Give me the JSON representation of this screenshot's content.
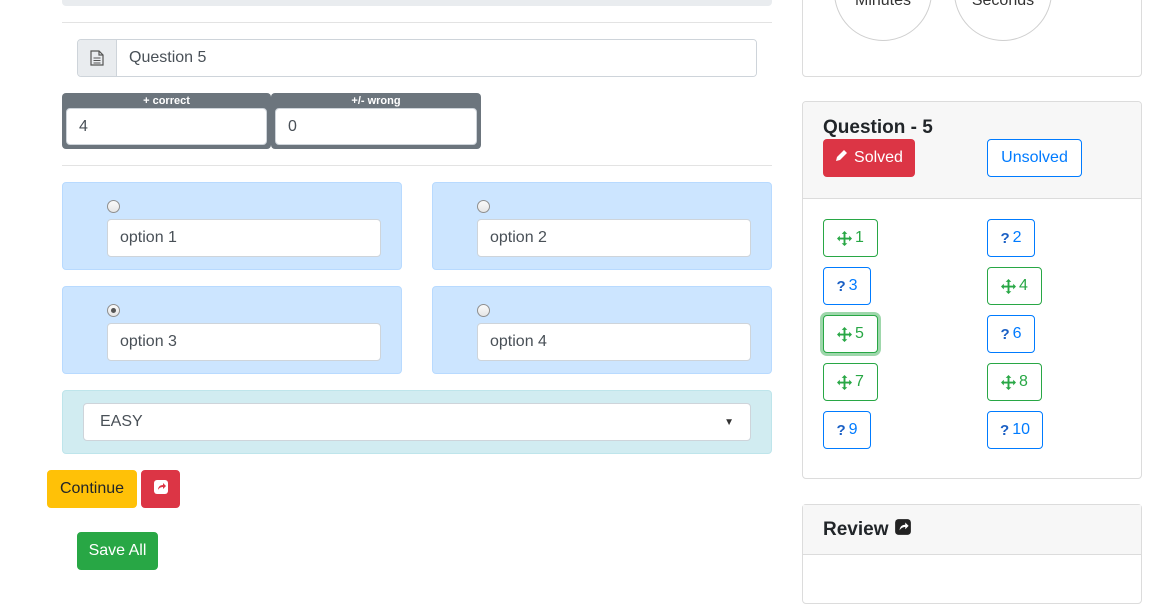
{
  "timer": {
    "minutes_label": "Minutes",
    "seconds_label": "Seconds"
  },
  "question": {
    "title_value": "Question 5"
  },
  "marks": {
    "correct_label": "+ correct",
    "correct_value": "4",
    "wrong_label": "+/- wrong",
    "wrong_value": "0"
  },
  "options": [
    {
      "value": "option 1",
      "checked": false
    },
    {
      "value": "option 2",
      "checked": false
    },
    {
      "value": "option 3",
      "checked": true
    },
    {
      "value": "option 4",
      "checked": false
    }
  ],
  "difficulty": {
    "selected": "EASY"
  },
  "actions": {
    "continue_label": "Continue",
    "save_all_label": "Save All"
  },
  "navigator": {
    "title": "Question - 5",
    "solved_label": "Solved",
    "unsolved_label": "Unsolved",
    "current": 5,
    "questions": [
      {
        "label": "1",
        "status": "solved"
      },
      {
        "label": "2",
        "status": "unsolved"
      },
      {
        "label": "3",
        "status": "unsolved"
      },
      {
        "label": "4",
        "status": "solved"
      },
      {
        "label": "5",
        "status": "solved"
      },
      {
        "label": "6",
        "status": "unsolved"
      },
      {
        "label": "7",
        "status": "solved"
      },
      {
        "label": "8",
        "status": "solved"
      },
      {
        "label": "9",
        "status": "unsolved"
      },
      {
        "label": "10",
        "status": "unsolved"
      }
    ]
  },
  "review": {
    "title": "Review"
  },
  "colors": {
    "solved": "#28a745",
    "unsolved": "#007bff",
    "danger": "#dc3545",
    "warning": "#ffc107",
    "option_bg": "#cce5ff",
    "difficulty_bg": "#d1ecf1"
  }
}
